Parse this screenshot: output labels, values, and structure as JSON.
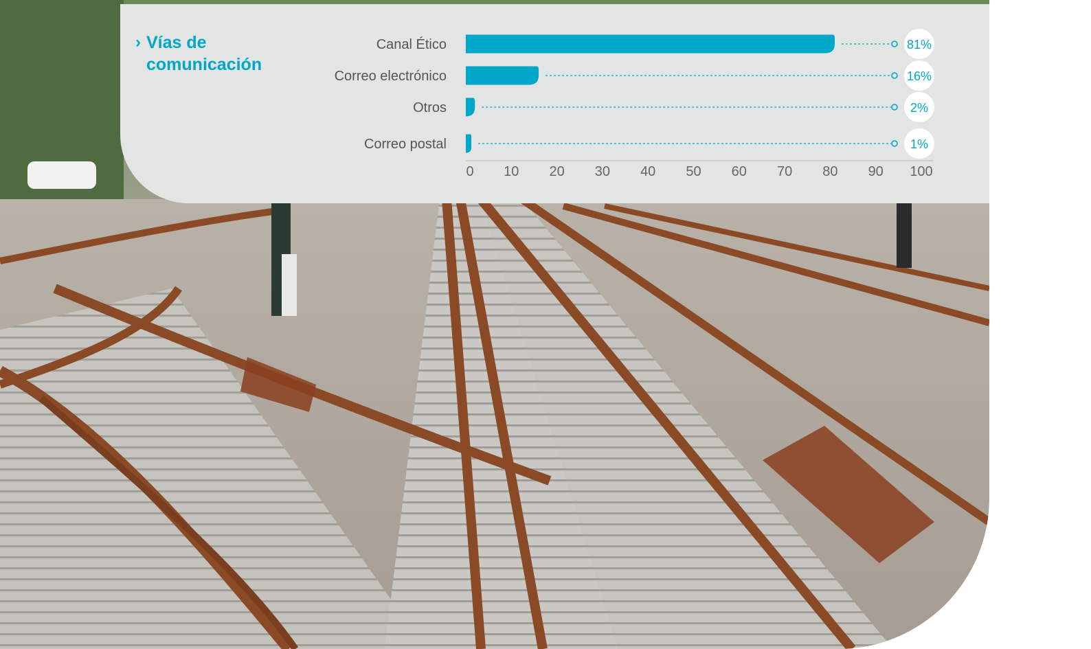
{
  "section": {
    "chevron": "›",
    "title": "Vías de comunicación"
  },
  "colors": {
    "accent": "#00a7c9",
    "panel": "#e3e4e4"
  },
  "chart_data": {
    "type": "bar",
    "orientation": "horizontal",
    "categories": [
      "Canal Ético",
      "Correo electrónico",
      "Otros",
      "Correo postal"
    ],
    "values": [
      81,
      16,
      2,
      1
    ],
    "value_labels": [
      "81%",
      "16%",
      "2%",
      "1%"
    ],
    "xlim": [
      0,
      100
    ],
    "xticks": [
      "0",
      "10",
      "20",
      "30",
      "40",
      "50",
      "60",
      "70",
      "80",
      "90",
      "100"
    ],
    "grid": false,
    "legend": "none"
  },
  "background_image": "railway-tracks-photo"
}
